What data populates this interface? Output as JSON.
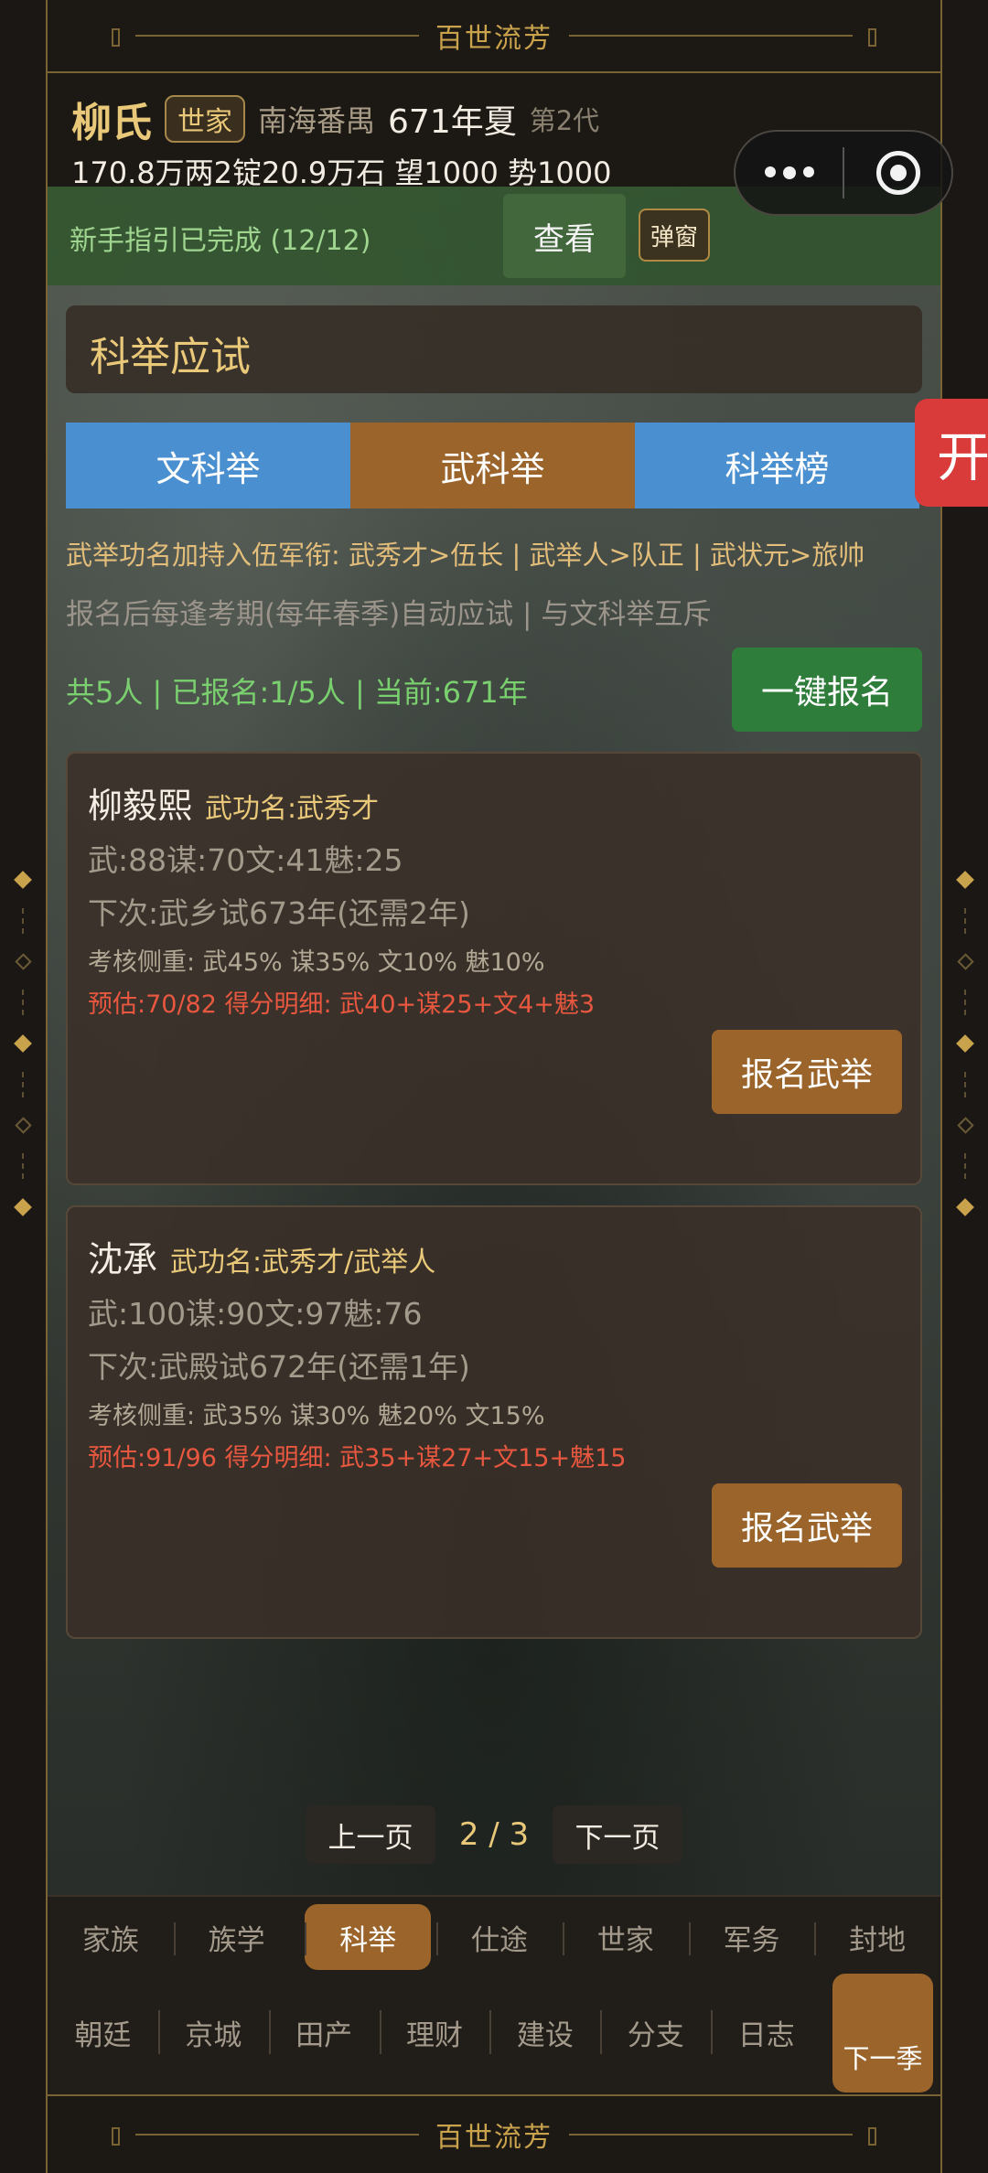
{
  "banner": {
    "top_title": "百世流芳",
    "bottom_title": "百世流芳"
  },
  "header": {
    "clan_name": "柳氏",
    "clan_badge": "世家",
    "place": "南海番禺",
    "season": "671年夏",
    "generation": "第2代",
    "wealth": "170.8万两2锭20.9万石  望1000  势1000"
  },
  "guide": {
    "text": "新手指引已完成 (12/12)",
    "view_label": "查看",
    "popup_label": "弹窗"
  },
  "section": {
    "title": "科举应试"
  },
  "tabs": [
    {
      "label": "文科举"
    },
    {
      "label": "武科举"
    },
    {
      "label": "科举榜"
    }
  ],
  "side_tab": {
    "label": "开"
  },
  "rules": {
    "line1": "武举功名加持入伍军衔: 武秀才>伍长 | 武举人>队正 | 武状元>旅帅",
    "line2": "报名后每逢考期(每年春季)自动应试 | 与文科举互斥"
  },
  "summary": {
    "text": "共5人 | 已报名:1/5人 | 当前:671年",
    "oneclick_label": "一键报名"
  },
  "candidates": [
    {
      "name": "柳毅熙",
      "title": "武功名:武秀才",
      "stats": "武:88谋:70文:41魅:25",
      "next": "下次:武乡试673年(还需2年)",
      "weight": "考核侧重: 武45% 谋35% 文10% 魅10%",
      "estimate": "预估:70/82  得分明细: 武40+谋25+文4+魅3",
      "button": "报名武举"
    },
    {
      "name": "沈承",
      "title": "武功名:武秀才/武举人",
      "stats": "武:100谋:90文:97魅:76",
      "next": "下次:武殿试672年(还需1年)",
      "weight": "考核侧重: 武35% 谋30% 魅20% 文15%",
      "estimate": "预估:91/96  得分明细: 武35+谋27+文15+魅15",
      "button": "报名武举"
    }
  ],
  "pager": {
    "prev": "上一页",
    "page": "2 / 3",
    "next": "下一页"
  },
  "nav": {
    "row1": [
      "家族",
      "族学",
      "科举",
      "仕途",
      "世家",
      "军务",
      "封地"
    ],
    "row2": [
      "朝廷",
      "京城",
      "田产",
      "理财",
      "建设",
      "分支",
      "日志"
    ],
    "next_season": "下一季"
  },
  "colors": {
    "accent_gold": "#e9c879",
    "active_tab": "#9a642a",
    "inactive_tab": "#4a8fcf",
    "green": "#2f7d3b",
    "red_estimate": "#e8573f"
  }
}
